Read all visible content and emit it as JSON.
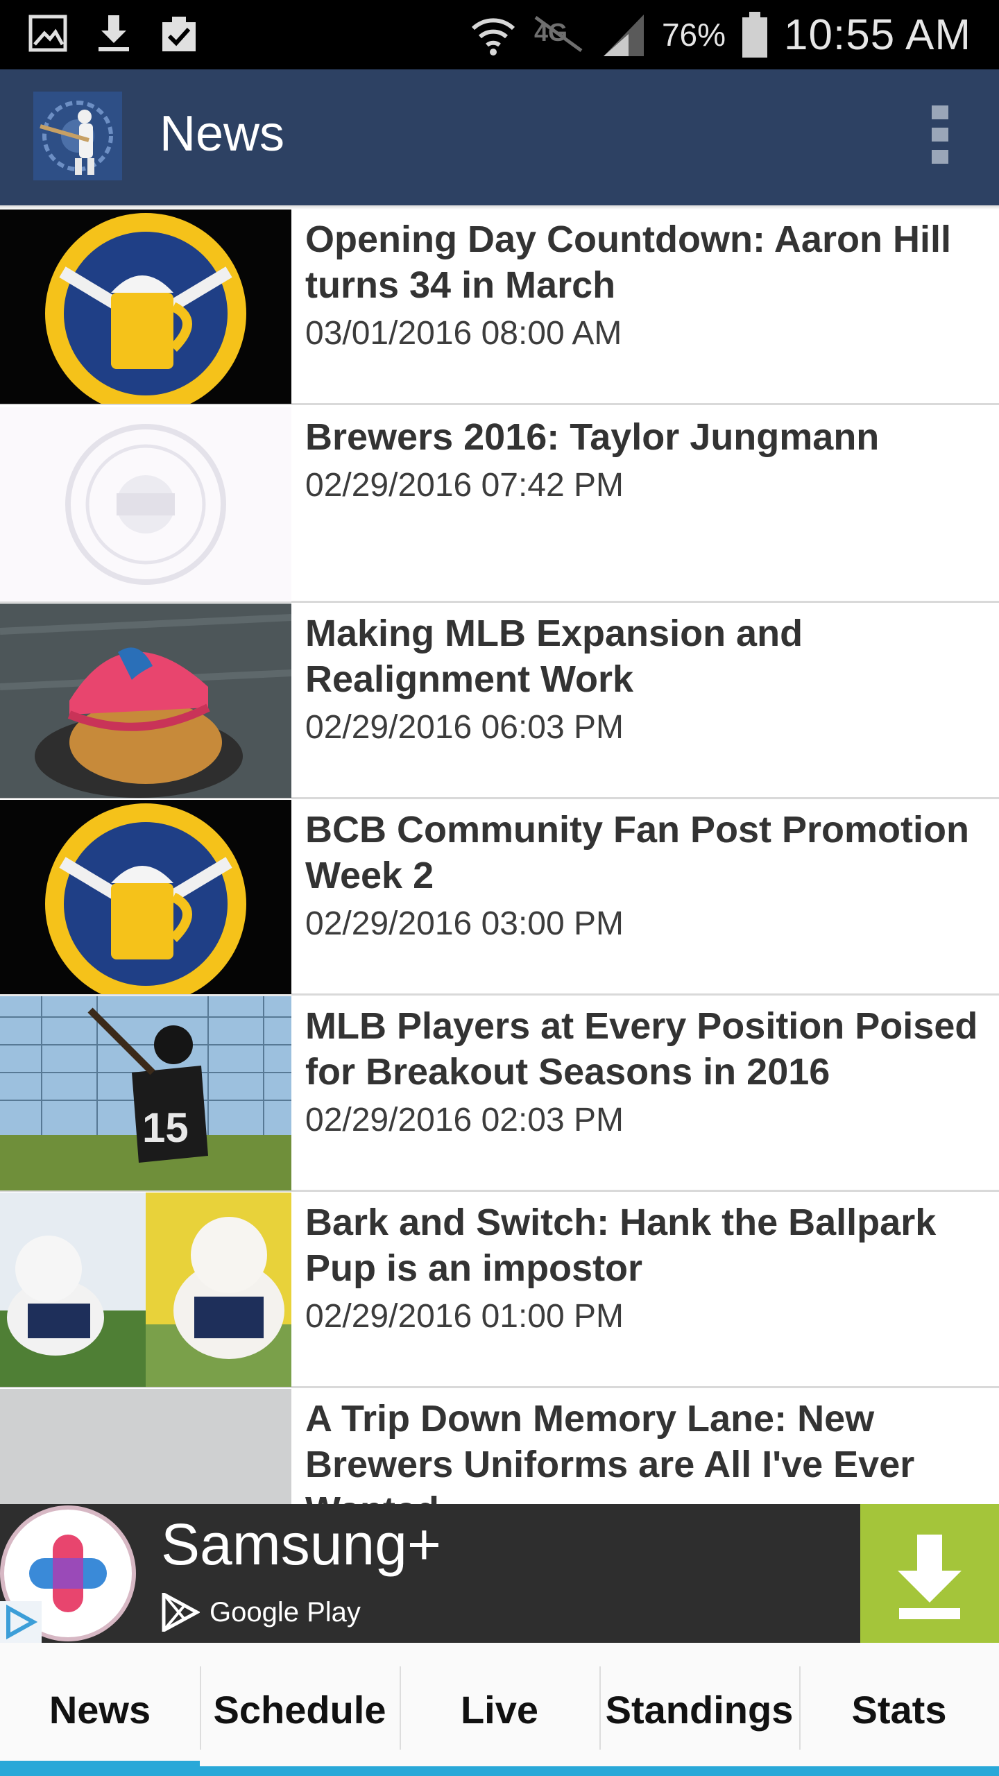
{
  "status_bar": {
    "battery_percent": "76%",
    "time": "10:55 AM",
    "left_icons": [
      "gallery-icon",
      "download-icon",
      "clipboard-check-icon"
    ],
    "right_icons": [
      "wifi-icon",
      "4g-lte-icon",
      "signal-icon",
      "battery-icon"
    ]
  },
  "app_bar": {
    "title": "News",
    "logo_icon": "batter-logo-icon",
    "menu_icon": "overflow-menu-icon"
  },
  "news": [
    {
      "title": "Opening Day Countdown: Aaron Hill turns 34 in March",
      "date": "03/01/2016 08:00 AM",
      "thumb": "brewers-logo"
    },
    {
      "title": "Brewers 2016: Taylor Jungmann",
      "date": "02/29/2016 07:42 PM",
      "thumb": "city-seal"
    },
    {
      "title": "Making MLB Expansion and Realignment Work",
      "date": "02/29/2016 06:03 PM",
      "thumb": "cap-and-glove"
    },
    {
      "title": "BCB Community Fan Post Promotion Week 2",
      "date": "02/29/2016 03:00 PM",
      "thumb": "brewers-logo"
    },
    {
      "title": "MLB Players at Every Position Poised for Breakout Seasons in 2016",
      "date": "02/29/2016 02:03 PM",
      "thumb": "batter-photo"
    },
    {
      "title": "Bark and Switch: Hank the Ballpark Pup is an impostor",
      "date": "02/29/2016 01:00 PM",
      "thumb": "dog-photo"
    },
    {
      "title": "A Trip Down Memory Lane: New Brewers Uniforms are All I've Ever Wanted",
      "date": "",
      "thumb": "gray-placeholder"
    }
  ],
  "ad": {
    "app_name": "Samsung+",
    "store": "Google Play",
    "colors": {
      "background": "#2e2e2e",
      "download": "#a4c53a"
    }
  },
  "tabs": [
    {
      "label": "News",
      "active": true
    },
    {
      "label": "Schedule",
      "active": false
    },
    {
      "label": "Live",
      "active": false
    },
    {
      "label": "Standings",
      "active": false
    },
    {
      "label": "Stats",
      "active": false
    }
  ],
  "colors": {
    "app_bar": "#2d4163",
    "tab_indicator": "#29a8d8",
    "title_text": "#333333"
  }
}
